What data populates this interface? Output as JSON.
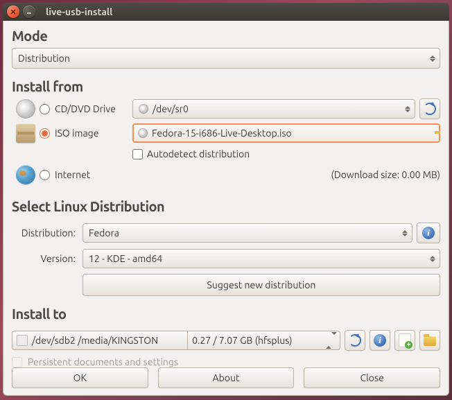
{
  "window": {
    "title": "live-usb-install"
  },
  "mode": {
    "heading": "Mode",
    "selected": "Distribution"
  },
  "install_from": {
    "heading": "Install from",
    "options": {
      "cd": {
        "label": "CD/DVD Drive",
        "device": "/dev/sr0",
        "checked": false
      },
      "iso": {
        "label": "ISO image",
        "file": "Fedora-15-i686-Live-Desktop.iso",
        "autodetect_label": "Autodetect distribution",
        "autodetect_checked": false,
        "checked": true
      },
      "internet": {
        "label": "Internet",
        "download_size_text": "(Download size: 0.00 MB)",
        "checked": false
      }
    }
  },
  "select_dist": {
    "heading": "Select Linux Distribution",
    "distribution_label": "Distribution:",
    "distribution_value": "Fedora",
    "version_label": "Version:",
    "version_value": "12 - KDE - amd64",
    "suggest_button": "Suggest new distribution"
  },
  "install_to": {
    "heading": "Install to",
    "device": "/dev/sdb2 /media/KINGSTON",
    "capacity": "0.27 / 7.07 GB (hfsplus)",
    "persist_label": "Persistent documents and settings",
    "persist_enabled": false
  },
  "buttons": {
    "ok": "OK",
    "about": "About",
    "close": "Close"
  }
}
